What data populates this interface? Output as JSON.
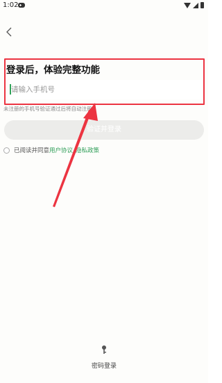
{
  "status_bar": {
    "time": "1:02"
  },
  "login": {
    "title": "登录后，体验完整功能",
    "phone_placeholder": "请输入手机号",
    "hint": "未注册的手机号验证通过后将自动注册",
    "submit_label": "验证并登录",
    "agreement": {
      "prefix": "已阅读并同意",
      "user_agreement": "用户协议",
      "separator": "",
      "privacy_policy": "隐私政策"
    }
  },
  "footer": {
    "password_login_label": "密码登录",
    "icon": "key-icon"
  },
  "colors": {
    "accent": "#2f9e58",
    "annotation": "#ec3441",
    "button_disabled": "#ececea"
  }
}
